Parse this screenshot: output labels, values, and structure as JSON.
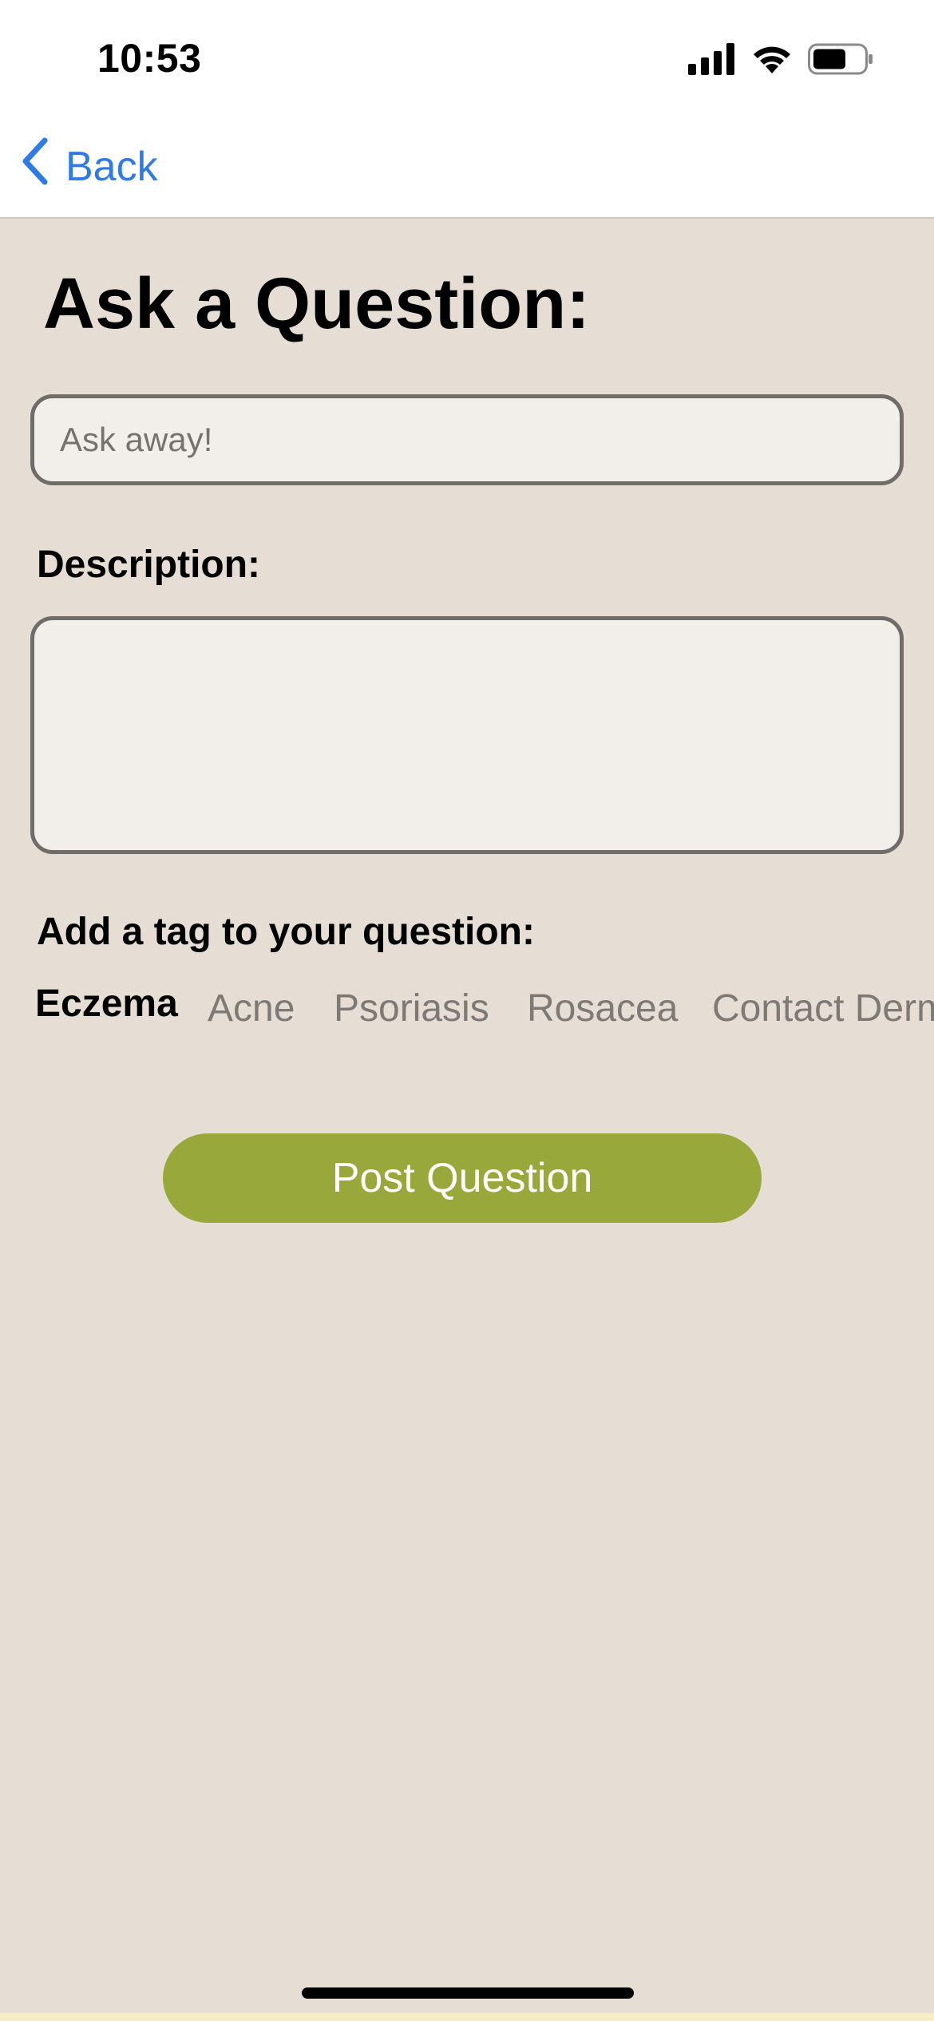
{
  "status_bar": {
    "time": "10:53",
    "icons": [
      "cellular-signal-icon",
      "wifi-icon",
      "battery-icon"
    ]
  },
  "nav": {
    "back_label": "Back",
    "back_icon": "chevron-left-icon",
    "accent_color": "#2f7be6"
  },
  "page": {
    "title": "Ask a Question:",
    "background_color": "#e6ddd5"
  },
  "question_input": {
    "value": "",
    "placeholder": "Ask away!"
  },
  "description": {
    "label": "Description:",
    "value": ""
  },
  "tags": {
    "label": "Add a tag to your question:",
    "items": [
      {
        "label": "Eczema",
        "selected": true
      },
      {
        "label": "Acne",
        "selected": false
      },
      {
        "label": "Psoriasis",
        "selected": false
      },
      {
        "label": "Rosacea",
        "selected": false
      },
      {
        "label": "Contact Derm",
        "selected": false
      }
    ]
  },
  "post_button": {
    "label": "Post Question",
    "color": "#98a83a"
  }
}
